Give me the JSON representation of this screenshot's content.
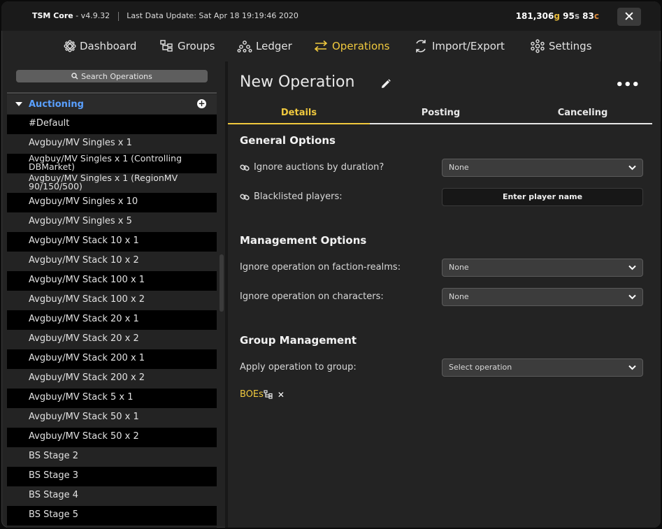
{
  "window": {
    "app_name": "TSM Core",
    "version": "- v4.9.32",
    "last_update": "Last Data Update: Sat Apr 18 19:19:46 2020",
    "gold": "181,306",
    "gold_unit": "g",
    "silver": "95",
    "silver_unit": "s",
    "copper": "83",
    "copper_unit": "c",
    "close_glyph": "✕"
  },
  "nav": {
    "items": [
      {
        "label": "Dashboard",
        "icon": "dashboard-icon"
      },
      {
        "label": "Groups",
        "icon": "groups-icon"
      },
      {
        "label": "Ledger",
        "icon": "ledger-icon"
      },
      {
        "label": "Operations",
        "icon": "operations-icon",
        "active": true
      },
      {
        "label": "Import/Export",
        "icon": "import-export-icon"
      },
      {
        "label": "Settings",
        "icon": "settings-icon"
      }
    ]
  },
  "sidebar": {
    "search_placeholder": "Search Operations",
    "module": "Auctioning",
    "items": [
      "#Default",
      "Avgbuy/MV Singles x 1",
      "Avgbuy/MV Singles x 1 (Controlling DBMarket)",
      "Avgbuy/MV Singles x 1 (RegionMV 90/150/500)",
      "Avgbuy/MV Singles x 10",
      "Avgbuy/MV Singles x 5",
      "Avgbuy/MV Stack 10 x 1",
      "Avgbuy/MV Stack 10 x 2",
      "Avgbuy/MV Stack 100 x 1",
      "Avgbuy/MV Stack 100 x 2",
      "Avgbuy/MV Stack 20 x 1",
      "Avgbuy/MV Stack 20 x 2",
      "Avgbuy/MV Stack 200 x 1",
      "Avgbuy/MV Stack 200 x 2",
      "Avgbuy/MV Stack 5 x 1",
      "Avgbuy/MV Stack 50 x 1",
      "Avgbuy/MV Stack 50 x 2",
      "BS Stage 2",
      "BS Stage 3",
      "BS Stage 4",
      "BS Stage 5"
    ]
  },
  "content": {
    "title": "New Operation",
    "more_glyph": "•••",
    "tabs": [
      "Details",
      "Posting",
      "Canceling"
    ],
    "general": {
      "heading": "General Options",
      "ignore_duration_label": "Ignore auctions by duration?",
      "ignore_duration_value": "None",
      "blacklist_label": "Blacklisted players:",
      "blacklist_placeholder": "Enter player name"
    },
    "management": {
      "heading": "Management Options",
      "faction_label": "Ignore operation on faction-realms:",
      "faction_value": "None",
      "characters_label": "Ignore operation on characters:",
      "characters_value": "None"
    },
    "group": {
      "heading": "Group Management",
      "apply_label": "Apply operation to group:",
      "apply_value": "Select operation",
      "tag": "BOEs",
      "remove_glyph": "✕"
    }
  },
  "colors": {
    "accent": "#f0c93e",
    "module_blue": "#5aa0ff",
    "background": "#232323"
  }
}
